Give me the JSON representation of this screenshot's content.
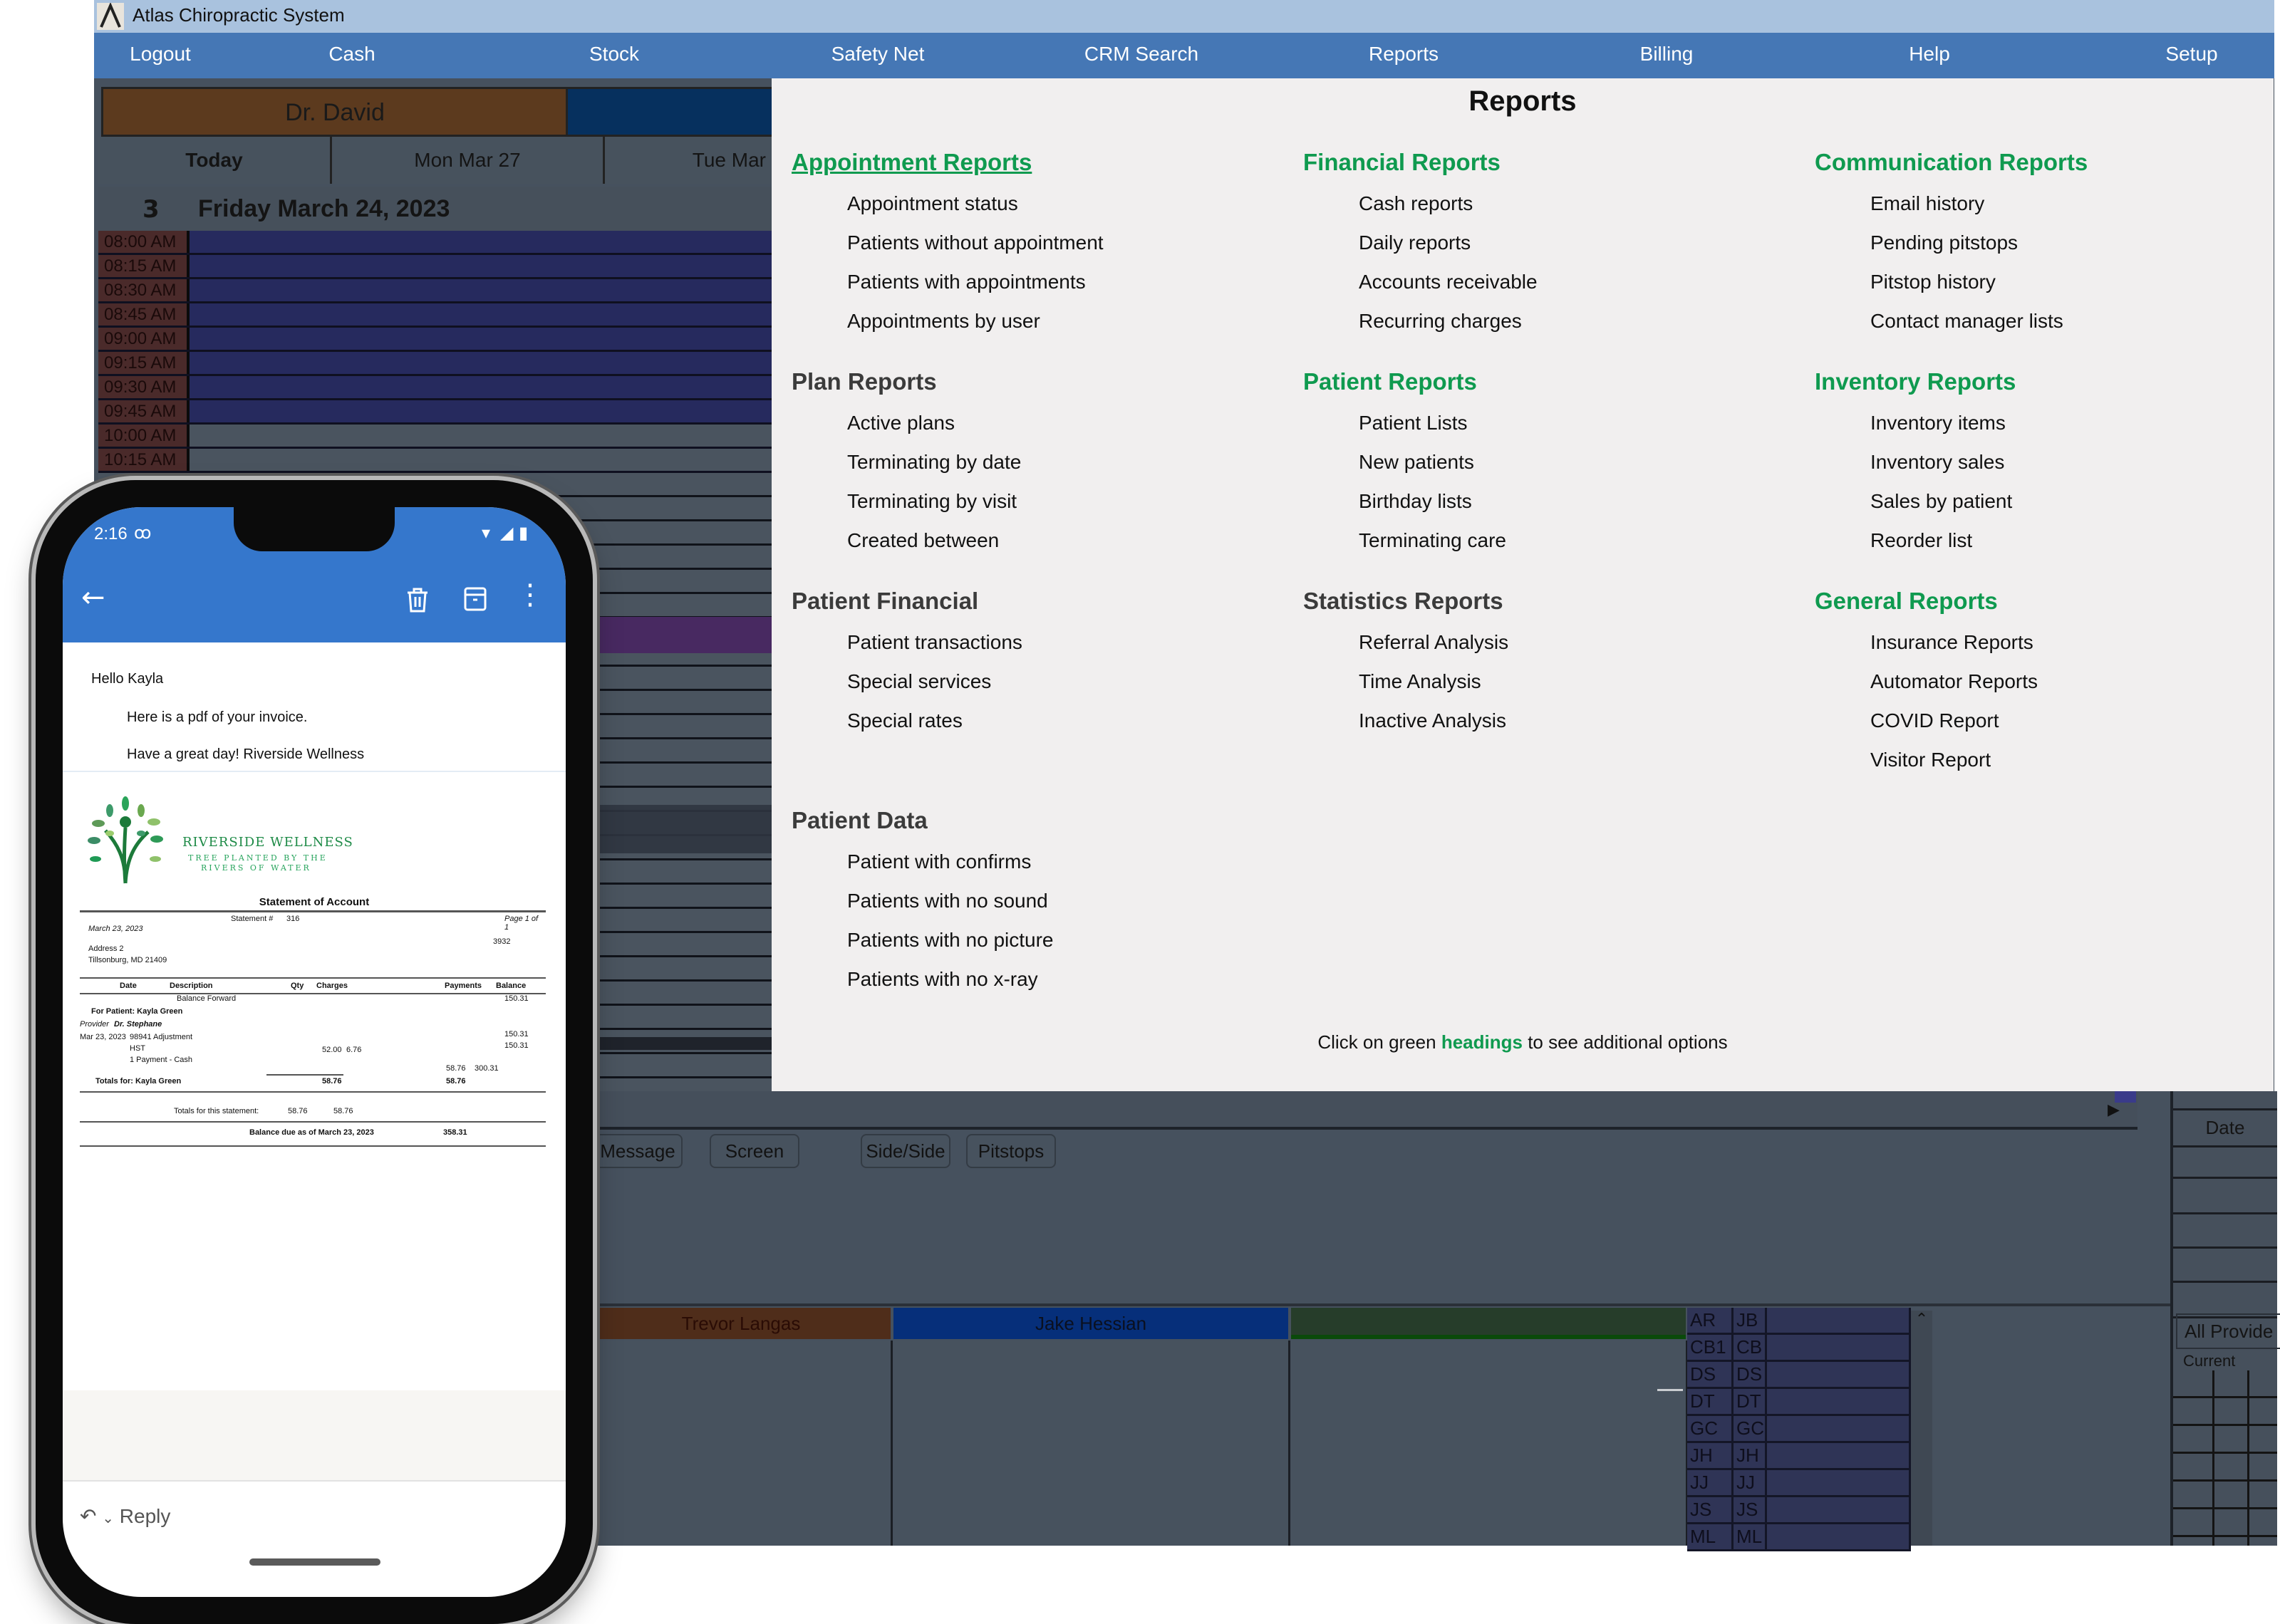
{
  "window": {
    "title": "Atlas Chiropractic System"
  },
  "nav": [
    "Logout",
    "Cash",
    "Stock",
    "Safety Net",
    "CRM Search",
    "Reports",
    "Billing",
    "Help",
    "Setup"
  ],
  "scheduler": {
    "provider": "Dr. David",
    "day_tabs": [
      "Today",
      "Mon Mar 27",
      "Tue Mar"
    ],
    "week_number": "3",
    "date": "Friday March 24, 2023",
    "time_slots": [
      "08:00 AM",
      "08:15 AM",
      "08:30 AM",
      "08:45 AM",
      "09:00 AM",
      "09:15 AM",
      "09:30 AM",
      "09:45 AM",
      "10:00 AM",
      "10:15 AM"
    ],
    "toolbar_buttons": [
      "Message",
      "Screen",
      "Side/Side",
      "Pitstops"
    ],
    "providers_bottom": [
      "Trevor Langas",
      "Jake Hessian",
      ""
    ],
    "initials_left": [
      "AR",
      "CB1",
      "DS",
      "DT",
      "GC",
      "JH",
      "JJ",
      "JS",
      "ML"
    ],
    "initials_right": [
      "JB",
      "CB",
      "DS",
      "DT",
      "GC",
      "JH",
      "JJ",
      "JS",
      "ML"
    ],
    "right_panel": {
      "date_header": "Date",
      "provider_filter": "All Provide",
      "current_label": "Current"
    }
  },
  "reports": {
    "title": "Reports",
    "hint_before": "Click on green",
    "hint_link": "headings",
    "hint_after": "to see additional options",
    "accent_color": "#0f9a4f",
    "columns": [
      [
        {
          "heading": "Appointment Reports",
          "green": true,
          "items": [
            "Appointment status",
            "Patients without appointment",
            "Patients with appointments",
            "Appointments by user"
          ]
        },
        {
          "heading": "Plan Reports",
          "green": false,
          "items": [
            "Active plans",
            "Terminating by date",
            "Terminating by visit",
            "Created between"
          ]
        },
        {
          "heading": "Patient Financial",
          "green": false,
          "items": [
            "Patient transactions",
            "Special services",
            "Special rates"
          ]
        },
        {
          "heading": "Patient Data",
          "green": false,
          "items": [
            "Patient with confirms",
            "Patients with no sound",
            "Patients with no picture",
            "Patients with no x-ray"
          ]
        }
      ],
      [
        {
          "heading": "Financial Reports",
          "green": true,
          "items": [
            "Cash reports",
            "Daily reports",
            "Accounts receivable",
            "Recurring charges"
          ]
        },
        {
          "heading": "Patient Reports",
          "green": true,
          "items": [
            "Patient Lists",
            "New patients",
            "Birthday lists",
            "Terminating care"
          ]
        },
        {
          "heading": "Statistics Reports",
          "green": false,
          "items": [
            "Referral Analysis",
            "Time Analysis",
            "Inactive Analysis"
          ]
        }
      ],
      [
        {
          "heading": "Communication Reports",
          "green": true,
          "items": [
            "Email history",
            "Pending pitstops",
            "Pitstop history",
            "Contact manager lists"
          ]
        },
        {
          "heading": "Inventory Reports",
          "green": true,
          "items": [
            "Inventory items",
            "Inventory sales",
            "Sales by patient",
            "Reorder list"
          ]
        },
        {
          "heading": "General Reports",
          "green": true,
          "items": [
            "Insurance Reports",
            "Automator Reports",
            "COVID Report",
            "Visitor Report"
          ]
        }
      ]
    ]
  },
  "phone": {
    "status_time": "2:16",
    "mail": {
      "greeting": "Hello Kayla",
      "line1": "Here is a pdf of your invoice.",
      "line2": "Have a great day! Riverside Wellness"
    },
    "reply_label": "Reply",
    "invoice": {
      "brand": "RIVERSIDE WELLNESS",
      "tagline1": "TREE PLANTED BY THE",
      "tagline2": "RIVERS OF WATER",
      "title": "Statement of Account",
      "statement_label": "Statement #",
      "statement_no": "316",
      "page": "Page 1 of 1",
      "date": "March 23, 2023",
      "account_no": "3932",
      "address1": "Address 2",
      "address2": "Tillsonburg,  MD  21409",
      "headers": [
        "Date",
        "Description",
        "Qty",
        "Charges",
        "Payments",
        "Balance"
      ],
      "balance_forward_label": "Balance Forward",
      "balance_forward": "150.31",
      "patient": "For Patient: Kayla Green",
      "provider_label": "Provider",
      "provider": "Dr. Stephane",
      "rows": [
        {
          "date": "Mar 23, 2023",
          "desc": "98941 Adjustment",
          "charges": "",
          "tax": "",
          "payments": "",
          "balance": "150.31"
        },
        {
          "date": "",
          "desc": "HST",
          "charges": "52.00",
          "tax": "6.76",
          "payments": "",
          "balance": "150.31"
        },
        {
          "date": "",
          "desc": "1 Payment - Cash",
          "charges": "",
          "tax": "",
          "payments": "58.76",
          "balance": "300.31"
        }
      ],
      "totals_patient_label": "Totals for: Kayla Green",
      "totals_patient_charges": "58.76",
      "totals_patient_payments": "58.76",
      "totals_statement_label": "Totals for this statement:",
      "totals_statement_charges": "58.76",
      "totals_statement_payments": "58.76",
      "balance_due_label": "Balance due as of March 23, 2023",
      "balance_due": "358.31"
    }
  }
}
